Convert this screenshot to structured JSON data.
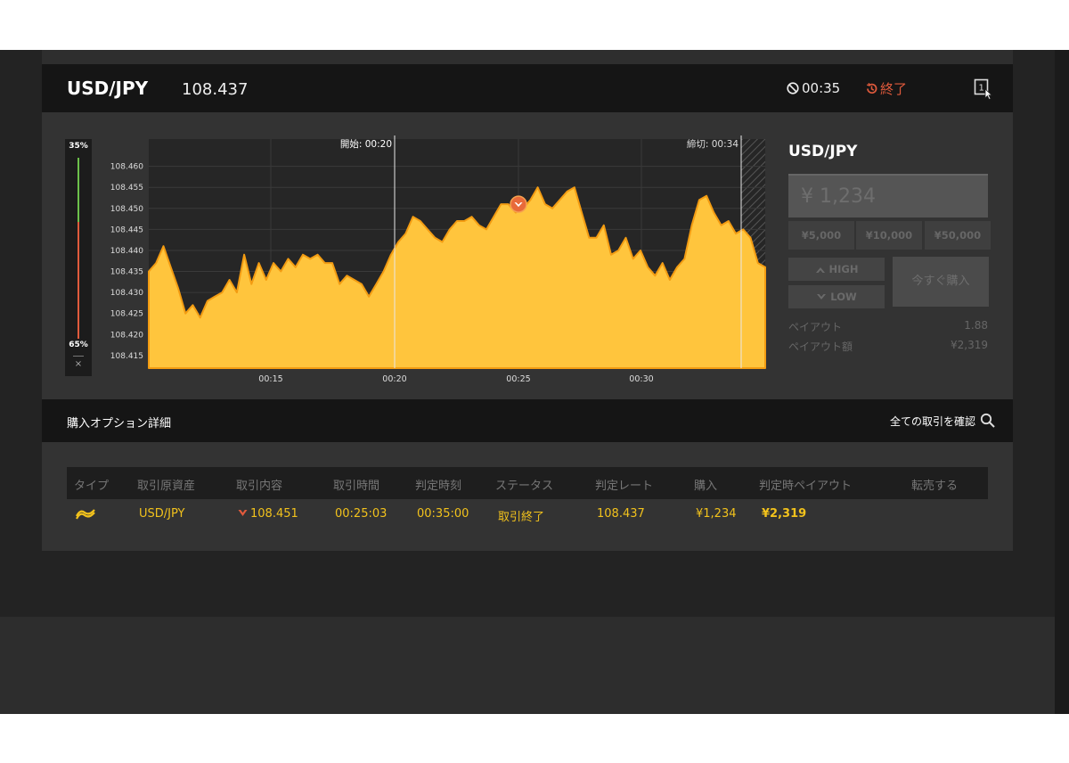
{
  "header": {
    "pair": "USD/JPY",
    "rate": "108.437",
    "timer": "00:35",
    "status": "終了"
  },
  "gauge": {
    "high_pct": "35%",
    "low_pct": "65%",
    "close_symbol": "×"
  },
  "chart_data": {
    "type": "area",
    "y_ticks": [
      "108.460",
      "108.455",
      "108.450",
      "108.445",
      "108.440",
      "108.435",
      "108.430",
      "108.425",
      "108.420",
      "108.415"
    ],
    "x_ticks": [
      "00:15",
      "00:20",
      "00:25",
      "00:30"
    ],
    "ylim": [
      108.412,
      108.4665
    ],
    "start_label": "開始: 00:20",
    "end_label": "締切: 00:34",
    "entry_marker": {
      "time": "00:25",
      "rate": 108.451
    },
    "series": [
      {
        "values": [
          108.435,
          108.437,
          108.441,
          108.436,
          108.431,
          108.425,
          108.427,
          108.424,
          108.428,
          108.429,
          108.43,
          108.433,
          108.43,
          108.439,
          108.432,
          108.437,
          108.433,
          108.437,
          108.435,
          108.438,
          108.436,
          108.439,
          108.438,
          108.439,
          108.437,
          108.437,
          108.432,
          108.434,
          108.433,
          108.432,
          108.429,
          108.432,
          108.435,
          108.439,
          108.442,
          108.444,
          108.448,
          108.447,
          108.445,
          108.443,
          108.442,
          108.445,
          108.447,
          108.447,
          108.448,
          108.446,
          108.445,
          108.448,
          108.451,
          108.451,
          108.449,
          108.45,
          108.452,
          108.455,
          108.451,
          108.45,
          108.452,
          108.454,
          108.455,
          108.449,
          108.443,
          108.443,
          108.446,
          108.439,
          108.44,
          108.443,
          108.438,
          108.44,
          108.436,
          108.434,
          108.437,
          108.433,
          108.436,
          108.438,
          108.446,
          108.452,
          108.453,
          108.449,
          108.446,
          108.447,
          108.444,
          108.445,
          108.443,
          108.437,
          108.436
        ]
      }
    ]
  },
  "trade_panel": {
    "pair": "USD/JPY",
    "amount": "¥ 1,234",
    "chips": [
      "¥5,000",
      "¥10,000",
      "¥50,000"
    ],
    "high_label": "HIGH",
    "low_label": "LOW",
    "buy_label": "今すぐ購入",
    "payout_label": "ペイアウト",
    "payout_value": "1.88",
    "payout_amount_label": "ペイアウト額",
    "payout_amount_value": "¥2,319"
  },
  "options": {
    "title": "購入オプション詳細",
    "all_trades_link": "全ての取引を確認",
    "columns": [
      "タイプ",
      "取引原資産",
      "取引内容",
      "取引時間",
      "判定時刻",
      "ステータス",
      "判定レート",
      "購入",
      "判定時ペイアウト",
      "転売する"
    ],
    "rows": [
      {
        "asset": "USD/JPY",
        "content": "108.451",
        "trade_time": "00:25:03",
        "judge_time": "00:35:00",
        "status": "取引終了",
        "judge_rate": "108.437",
        "purchase": "¥1,234",
        "payout": "¥2,319"
      }
    ]
  },
  "colors": {
    "accent": "#f2c21c",
    "area_fill": "#ffc53d",
    "area_stroke": "#f39c12",
    "marker": "#e86a3a",
    "status_red": "#e05a3c"
  }
}
